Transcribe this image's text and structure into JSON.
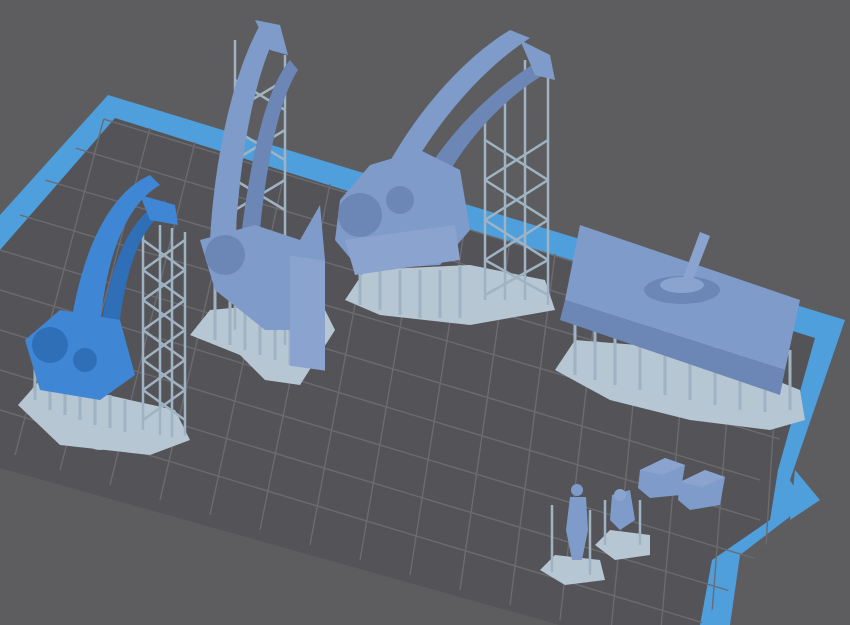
{
  "scene": {
    "title": "",
    "background_color": "#5d5d5f",
    "plate_fill_color": "#545458",
    "plate_border_color": "#4f9fdc",
    "grid_line_color": "#6b6b70",
    "model_color_selected": "#3f86d4",
    "model_color": "#7f9bc9",
    "support_color": "#9fb3c3",
    "support_base_color": "#b6c6d3"
  },
  "objects": [
    {
      "name": "drawbridge-tower-small",
      "selected": true
    },
    {
      "name": "drawbridge-tower-medium",
      "selected": false
    },
    {
      "name": "drawbridge-tower-large",
      "selected": false
    },
    {
      "name": "gun-deck-platform",
      "selected": false
    },
    {
      "name": "figure-soldier",
      "selected": false
    },
    {
      "name": "figure-seated",
      "selected": false
    },
    {
      "name": "crate-left",
      "selected": false
    },
    {
      "name": "crate-right",
      "selected": false
    }
  ]
}
